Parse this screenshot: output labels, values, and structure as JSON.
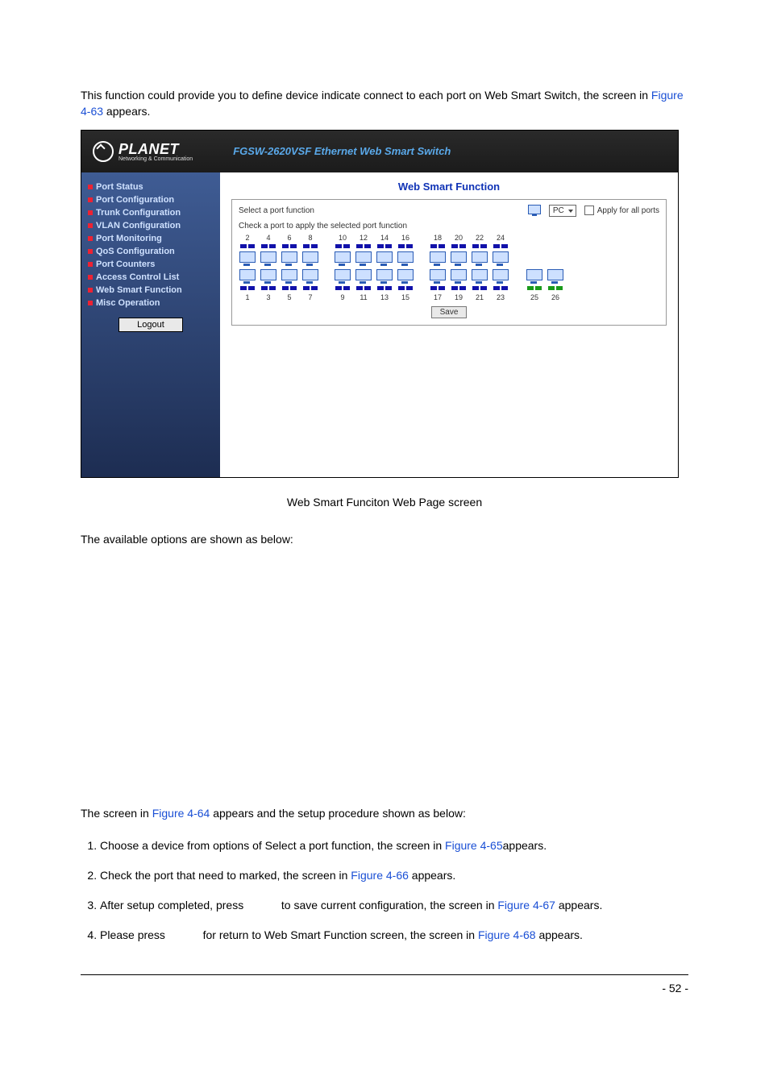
{
  "intro": {
    "pre": "This function could provide you to define device indicate connect to each port on Web Smart Switch, the screen in ",
    "link": "Figure 4-63",
    "post": " appears."
  },
  "screenshot": {
    "logo_text": "PLANET",
    "logo_sub": "Networking & Communication",
    "product_title": "FGSW-2620VSF Ethernet Web Smart Switch",
    "sidebar": {
      "items": [
        "Port Status",
        "Port Configuration",
        "Trunk Configuration",
        "VLAN Configuration",
        "Port Monitoring",
        "QoS Configuration",
        "Port Counters",
        "Access Control List",
        "Web Smart Function",
        "Misc Operation"
      ],
      "logout": "Logout"
    },
    "main": {
      "title": "Web Smart Function",
      "select_label": "Select a port function",
      "dropdown_value": "PC",
      "apply_label": "Apply for all ports",
      "hint": "Check a port to apply the selected port function",
      "top_ports": [
        "2",
        "4",
        "6",
        "8",
        "10",
        "12",
        "14",
        "16",
        "18",
        "20",
        "22",
        "24"
      ],
      "bot_ports": [
        "1",
        "3",
        "5",
        "7",
        "9",
        "11",
        "13",
        "15",
        "17",
        "19",
        "21",
        "23"
      ],
      "sfp_ports": [
        "25",
        "26"
      ],
      "save": "Save"
    }
  },
  "fig_caption": "Web Smart Funciton Web Page screen",
  "options_intro": "The available options are shown as below:",
  "steps_intro": {
    "pre": "The screen in ",
    "link": "Figure 4-64",
    "post": " appears and the setup procedure shown as below:"
  },
  "steps": [
    {
      "pre": "Choose a device from options of Select a port function, the screen in ",
      "link": "Figure 4-65",
      "post": "appears."
    },
    {
      "pre": "Check the port that need to marked, the screen in ",
      "link": "Figure 4-66",
      "post": " appears."
    },
    {
      "pre": "After setup completed, press ",
      "mid": " to save current configuration, the screen in ",
      "link": "Figure 4-67",
      "post": " appears."
    },
    {
      "pre": "Please press ",
      "mid": " for return to Web Smart Function screen, the screen in ",
      "link": "Figure 4-68",
      "post": " appears."
    }
  ],
  "page_number": "- 52 -"
}
